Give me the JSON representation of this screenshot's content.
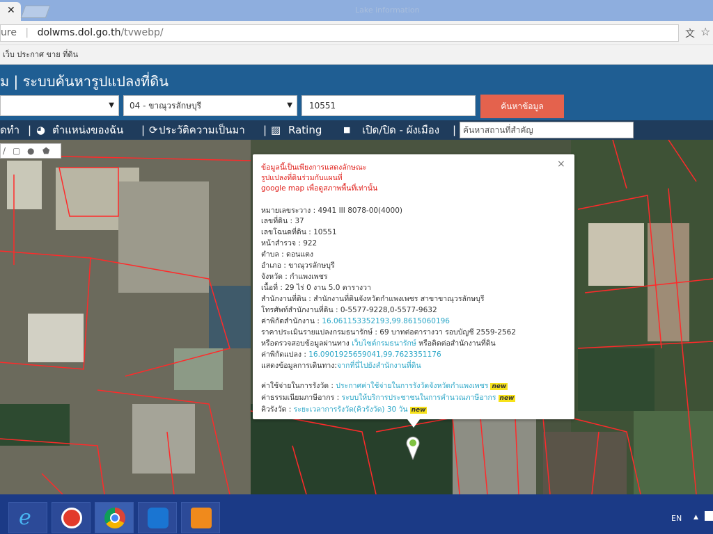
{
  "browser": {
    "tab_close": "✕",
    "window_title": "Lake information",
    "url_security": "ure",
    "url_host": "dolwms.dol.go.th",
    "url_path": "/tvwebp/",
    "bookmark": "เว็บ ประกาศ ขาย ที่ดิน",
    "translate_icon": "translate-icon",
    "star_icon": "star-icon"
  },
  "header": {
    "title": "ม | ระบบค้นหารูปแปลงที่ดิน"
  },
  "search": {
    "district_value": "04 - ขาณุวรลักษบุรี",
    "deed_value": "10551",
    "button": "ค้นหาข้อมูล"
  },
  "nav": {
    "item1": "ัดทำ",
    "item2": "ตำแหน่งของฉัน",
    "item3": "ประวัติความเป็นมา",
    "item4": "Rating",
    "item5": "เปิด/ปิด - ผังเมือง",
    "landmark_placeholder": "ค้นหาสถานที่สำคัญ",
    "sep": "|"
  },
  "popup": {
    "notice1": "ข้อมูลนี้เป็นเพียงการแสดงลักษณะ",
    "notice2": "รูปแปลงที่ดินร่วมกับแผนที่",
    "notice3a": "google map",
    "notice3b": " เพื่อดูสภาพพื้นที่เท่านั้น",
    "close": "×",
    "rows": [
      "หมายเลขระวาง : 4941 III 8078-00(4000)",
      "เลขที่ดิน : 37",
      "เลขโฉนดที่ดิน : 10551",
      "หน้าสำรวจ : 922",
      "ตำบล : ดอนแตง",
      "อำเภอ : ขาณุวรลักษบุรี",
      "จังหวัด : กำแพงเพชร",
      "เนื้อที่ : 29 ไร่ 0 งาน 5.0 ตารางวา",
      "สำนักงานที่ดิน : สำนักงานที่ดินจังหวัดกำแพงเพชร สาขาขาณุวรลักษบุรี",
      "โทรศัพท์สำนักงานที่ดิน : 0-5577-9228,0-5577-9632"
    ],
    "office_coord_label": "ค่าพิกัดสำนักงาน : ",
    "office_coord_value": "16.061153352193,99.8615060196",
    "appraisal": "ราคาประเมินรายแปลงกรมธนารักษ์ : 69 บาทต่อตารางวา รอบบัญชี 2559-2562",
    "check_pre": "หรือตรวจสอบข้อมูลผ่านทาง ",
    "check_link": "เว็บไซต์กรมธนารักษ์",
    "check_post": " หรือติดต่อสำนักงานที่ดิน",
    "parcel_coord_label": "ค่าพิกัดแปลง : ",
    "parcel_coord_value": "16.0901925659041,99.7623351176",
    "route_label": "แสดงข้อมูลการเดินทาง:",
    "route_link": "จากที่นี่ไปยังสำนักงานที่ดิน",
    "survey_fee_label": "ค่าใช้จ่ายในการรังวัด : ",
    "survey_fee_link": "ประกาศค่าใช้จ่ายในการรังวัดจังหวัดกำแพงเพชร",
    "tax_label": "ค่าธรรมเนียมภาษีอากร : ",
    "tax_link": "ระบบให้บริการประชาชนในการคำนวณภาษีอากร",
    "queue_label": "คิวรังวัด : ",
    "queue_link": "ระยะเวลาการรังวัด(คิวรังวัด) 30 วัน",
    "new_badge": "new"
  },
  "taskbar": {
    "lang": "EN",
    "tray_arrow": "▲",
    "apps": [
      "internet-explorer-icon",
      "app-red-icon",
      "chrome-icon",
      "teamviewer-icon",
      "pdf-icon"
    ]
  },
  "colors": {
    "header_blue": "#1f5e93",
    "nav_dark": "#1f3c5c",
    "search_button": "#e4624d",
    "parcel_line": "#ff2a2a",
    "link": "#2aa6c7",
    "notice_red": "#e0201b"
  }
}
